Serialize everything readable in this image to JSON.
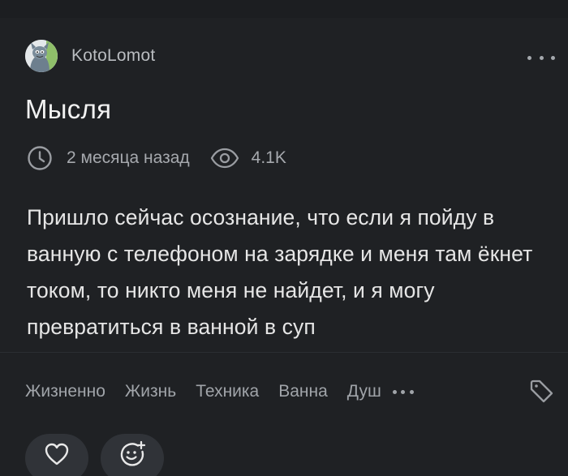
{
  "post": {
    "author": "KotoLomot",
    "title": "Мысля",
    "time_ago": "2 месяца назад",
    "views": "4.1K",
    "body": "Пришло сейчас осознание, что если я пойду в ванную с телефоном на зарядке и меня там ёкнет током, то никто меня не найдет, и я могу превратиться в ванной в суп",
    "tags": [
      "Жизненно",
      "Жизнь",
      "Техника",
      "Ванна",
      "Душ"
    ]
  },
  "icons": {
    "more": "more-dots-icon",
    "clock": "clock-icon",
    "eye": "eye-icon",
    "tags_more": "more-dots-icon",
    "tag": "tag-icon",
    "like": "heart-icon",
    "react": "smile-plus-icon"
  },
  "colors": {
    "background": "#1f2124",
    "text_primary": "#e6e6e6",
    "text_secondary": "#a6a9ae",
    "button_bg": "#303338"
  }
}
